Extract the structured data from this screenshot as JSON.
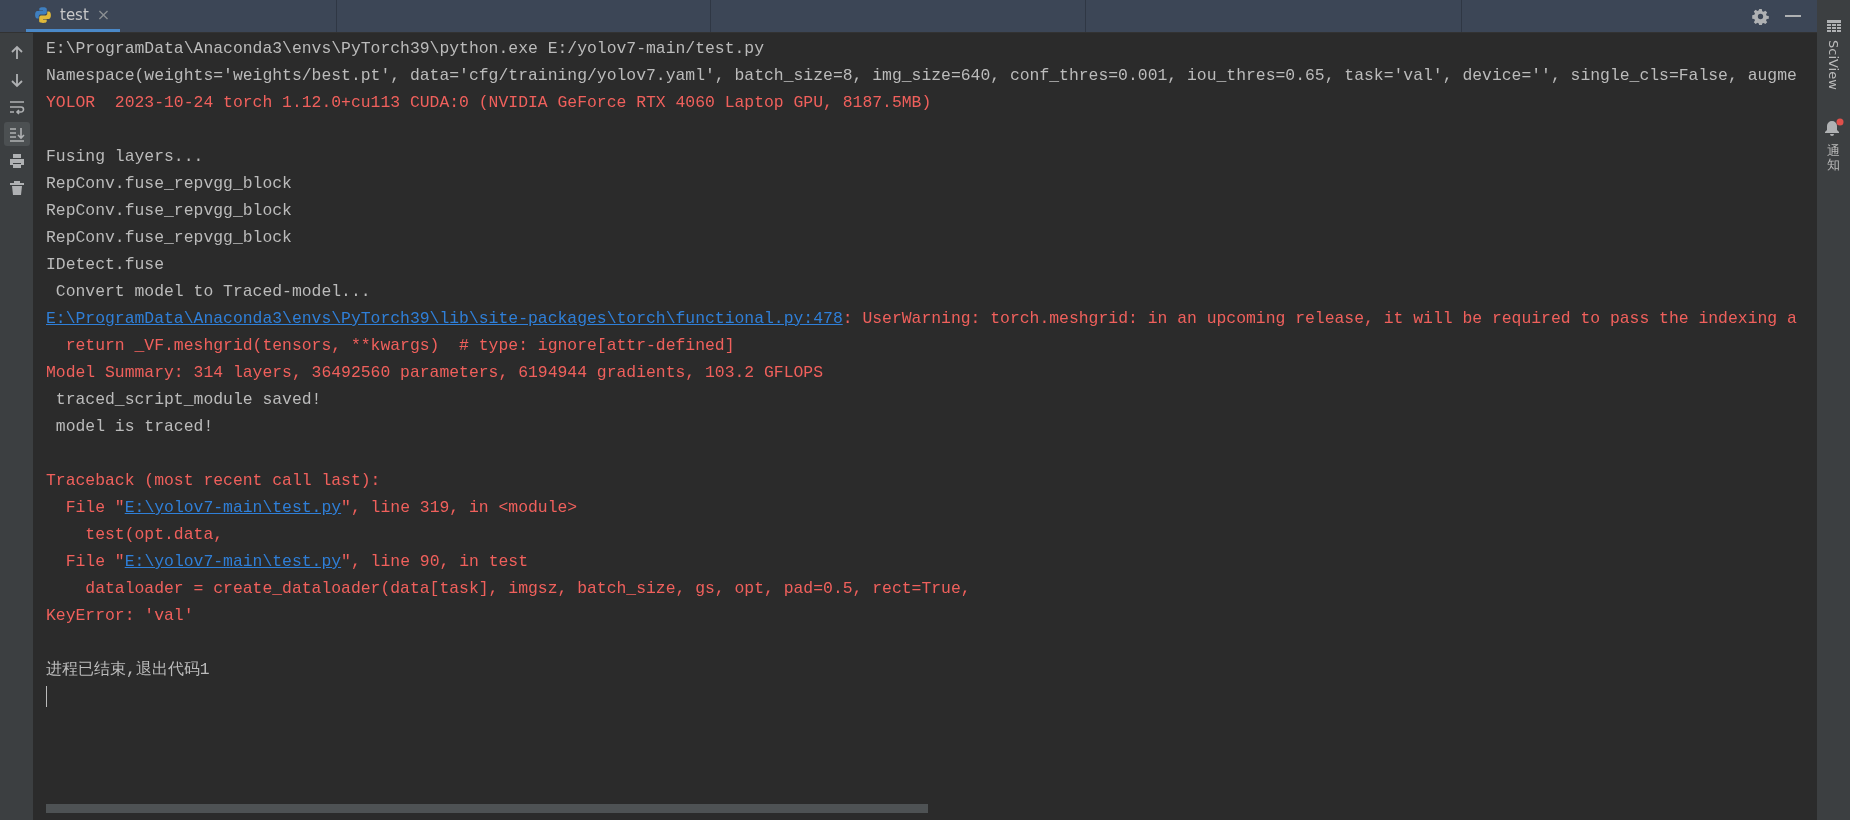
{
  "tab": {
    "label": "test",
    "selected": true,
    "close": "×"
  },
  "toolbar": [
    {
      "kind": "up",
      "on": false
    },
    {
      "kind": "down",
      "on": false
    },
    {
      "kind": "wrap",
      "on": false
    },
    {
      "kind": "scroll-end",
      "on": true
    },
    {
      "kind": "print",
      "on": false
    },
    {
      "kind": "trash",
      "on": false
    }
  ],
  "right_panel": [
    {
      "kind": "grid",
      "label": "SciView",
      "badge": false
    },
    {
      "kind": "bell",
      "label": "通知",
      "badge": true
    }
  ],
  "console_blocks": [
    {
      "lines": [
        [
          {
            "kind": "out",
            "text": "E:\\ProgramData\\Anaconda3\\envs\\PyTorch39\\python.exe E:/yolov7-main/test.py"
          }
        ],
        [
          {
            "kind": "out",
            "text": "Namespace(weights='weights/best.pt', data='cfg/training/yolov7.yaml', batch_size=8, img_size=640, conf_thres=0.001, iou_thres=0.65, task='val', device='', single_cls=False, augme"
          }
        ],
        [
          {
            "kind": "err",
            "text": "YOLOR  2023-10-24 torch 1.12.0+cu113 CUDA:0 (NVIDIA GeForce RTX 4060 Laptop GPU, 8187.5MB)"
          }
        ]
      ]
    },
    {
      "lines": [
        [
          {
            "kind": "out",
            "text": "Fusing layers... "
          }
        ],
        [
          {
            "kind": "out",
            "text": "RepConv.fuse_repvgg_block"
          }
        ],
        [
          {
            "kind": "out",
            "text": "RepConv.fuse_repvgg_block"
          }
        ],
        [
          {
            "kind": "out",
            "text": "RepConv.fuse_repvgg_block"
          }
        ],
        [
          {
            "kind": "out",
            "text": "IDetect.fuse"
          }
        ],
        [
          {
            "kind": "out",
            "text": " Convert model to Traced-model... "
          }
        ],
        [
          {
            "kind": "link",
            "text": "E:\\ProgramData\\Anaconda3\\envs\\PyTorch39\\lib\\site-packages\\torch\\functional.py:478"
          },
          {
            "kind": "err",
            "text": ": UserWarning: torch.meshgrid: in an upcoming release, it will be required to pass the indexing a"
          }
        ],
        [
          {
            "kind": "err",
            "text": "  return _VF.meshgrid(tensors, **kwargs)  # type: ignore[attr-defined]"
          }
        ],
        [
          {
            "kind": "err",
            "text": "Model Summary: 314 layers, 36492560 parameters, 6194944 gradients, 103.2 GFLOPS"
          }
        ],
        [
          {
            "kind": "out",
            "text": " traced_script_module saved! "
          }
        ],
        [
          {
            "kind": "out",
            "text": " model is traced! "
          }
        ]
      ]
    },
    {
      "lines": [
        [
          {
            "kind": "err",
            "text": "Traceback (most recent call last):"
          }
        ],
        [
          {
            "kind": "err",
            "text": "  File \""
          },
          {
            "kind": "link",
            "text": "E:\\yolov7-main\\test.py"
          },
          {
            "kind": "err",
            "text": "\", line 319, in <module>"
          }
        ],
        [
          {
            "kind": "err",
            "text": "    test(opt.data,"
          }
        ],
        [
          {
            "kind": "err",
            "text": "  File \""
          },
          {
            "kind": "link",
            "text": "E:\\yolov7-main\\test.py"
          },
          {
            "kind": "err",
            "text": "\", line 90, in test"
          }
        ],
        [
          {
            "kind": "err",
            "text": "    dataloader = create_dataloader(data[task], imgsz, batch_size, gs, opt, pad=0.5, rect=True,"
          }
        ],
        [
          {
            "kind": "err",
            "text": "KeyError: 'val'"
          }
        ]
      ]
    },
    {
      "lines": [
        [
          {
            "kind": "out",
            "text": "进程已结束,退出代码1"
          }
        ]
      ]
    }
  ]
}
